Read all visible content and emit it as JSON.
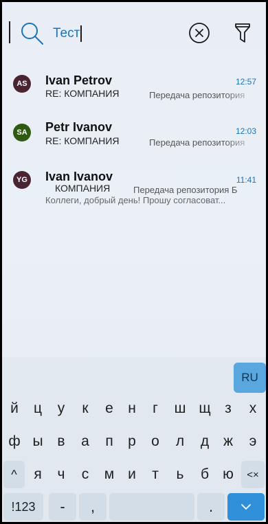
{
  "search": {
    "query": "Тест"
  },
  "messages": [
    {
      "initials": "AS",
      "avatar_color": "#4a2531",
      "sender": "Ivan Petrov",
      "time": "12:57",
      "subject": "RE: КОМПАНИЯ",
      "preview": "Передача репозитория"
    },
    {
      "initials": "SA",
      "avatar_color": "#2f5a12",
      "sender": "Petr Ivanov",
      "time": "12:03",
      "subject": "RE: КОМПАНИЯ",
      "preview": "Передача репозитория"
    },
    {
      "initials": "YG",
      "avatar_color": "#4a2531",
      "sender": "Ivan Ivanov",
      "time": "11:41",
      "subject": "КОМПАНИЯ",
      "preview": "Передача репозитория Б",
      "body": "Коллеги, добрый день! Прошу согласоват..."
    }
  ],
  "keyboard": {
    "language": "RU",
    "row1": [
      "й",
      "ц",
      "у",
      "к",
      "е",
      "н",
      "г",
      "ш",
      "щ",
      "з",
      "х"
    ],
    "row2": [
      "ф",
      "ы",
      "в",
      "а",
      "п",
      "р",
      "о",
      "л",
      "д",
      "ж",
      "э"
    ],
    "row3": [
      "я",
      "ч",
      "с",
      "м",
      "и",
      "т",
      "ь",
      "б",
      "ю"
    ],
    "shift": "^",
    "backspace": "<×",
    "numbers": "!123",
    "dash": "-",
    "comma": ",",
    "dot": "."
  },
  "colors": {
    "accent": "#1a73b8",
    "enter_key": "#2f8fd8",
    "lang_key": "#5aa6de"
  }
}
